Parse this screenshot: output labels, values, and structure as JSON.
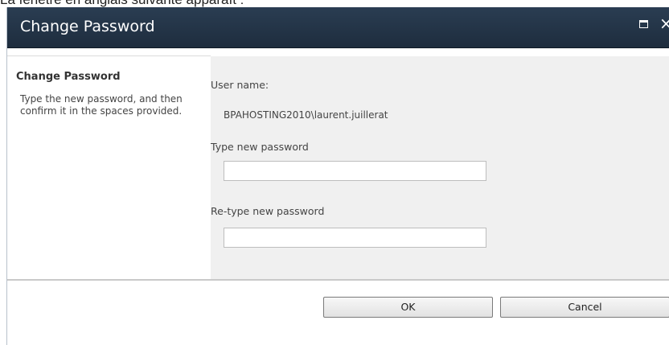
{
  "caption": "La fenêtre en anglais suivante apparaît :",
  "dialog": {
    "title": "Change Password",
    "maximize_icon": "maximize-icon",
    "close_icon": "close-icon",
    "close_glyph": "×"
  },
  "section": {
    "title": "Change Password",
    "description": "Type the new password, and then confirm it in the spaces provided."
  },
  "form": {
    "username_label": "User name:",
    "username_value": "BPAHOSTING2010\\laurent.juillerat",
    "new_password_label": "Type new password",
    "new_password_value": "",
    "retype_password_label": "Re-type new password",
    "retype_password_value": ""
  },
  "buttons": {
    "ok": "OK",
    "cancel": "Cancel"
  },
  "colors": {
    "titlebar": "#1e2d3e",
    "right_pane": "#f0f0f0",
    "button_border": "#7a7a7a"
  }
}
